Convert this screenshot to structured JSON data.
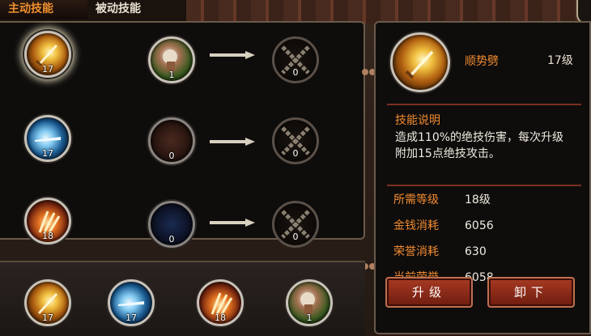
{
  "tabs": {
    "active": "主动技能",
    "passive": "被动技能"
  },
  "skill_rows": [
    {
      "base": {
        "level": "17",
        "theme": "gold"
      },
      "mid": {
        "level": "1",
        "theme": "fist"
      },
      "locked_level": "0"
    },
    {
      "base": {
        "level": "17",
        "theme": "blue"
      },
      "mid": {
        "level": "0",
        "theme": "dark-red"
      },
      "locked_level": "0"
    },
    {
      "base": {
        "level": "18",
        "theme": "fire"
      },
      "mid": {
        "level": "0",
        "theme": "dark-blue"
      },
      "locked_level": "0"
    }
  ],
  "equipped_bar": [
    {
      "level": "17",
      "theme": "gold"
    },
    {
      "level": "17",
      "theme": "blue"
    },
    {
      "level": "18",
      "theme": "fire"
    },
    {
      "level": "1",
      "theme": "fist"
    }
  ],
  "detail": {
    "name": "顺势劈",
    "level": "17级",
    "desc_title": "技能说明",
    "desc_text": "造成110%的绝技伤害，每次升级附加15点绝技攻击。",
    "stats": [
      {
        "label": "所需等级",
        "value": "18级"
      },
      {
        "label": "金钱消耗",
        "value": "6056"
      },
      {
        "label": "荣誉消耗",
        "value": "630"
      },
      {
        "label": "当前荣誉",
        "value": "6058"
      }
    ],
    "upgrade_label": "升级",
    "unequip_label": "卸下"
  },
  "colors": {
    "accent": "#f08a30",
    "button": "#a83a22"
  }
}
